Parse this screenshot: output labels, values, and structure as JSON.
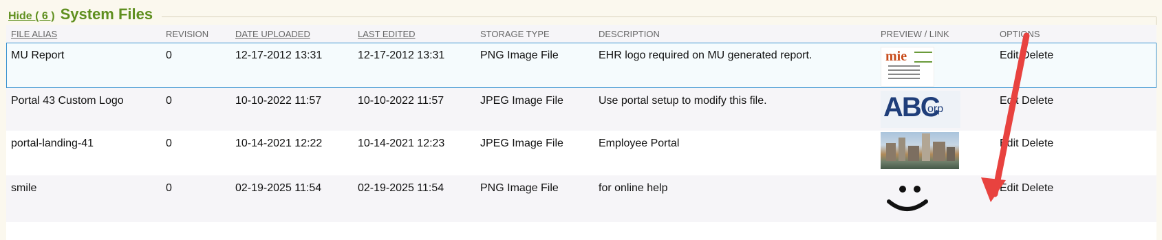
{
  "section": {
    "hide_label": "Hide ( 6 )",
    "title": "System Files"
  },
  "columns": {
    "file_alias": "FILE ALIAS",
    "revision": "REVISION",
    "date_uploaded": "DATE UPLOADED",
    "last_edited": "LAST EDITED",
    "storage_type": "STORAGE TYPE",
    "description": "DESCRIPTION",
    "preview_link": "PREVIEW / LINK",
    "options": "OPTIONS"
  },
  "rows": [
    {
      "alias": "MU Report",
      "revision": "0",
      "uploaded": "12-17-2012 13:31",
      "edited": "12-17-2012 13:31",
      "storage": "PNG Image File",
      "description": "EHR logo required on MU generated report.",
      "edit": "Edit",
      "delete": "Delete",
      "preview_icon": "mie-logo-thumbnail"
    },
    {
      "alias": "Portal 43 Custom Logo",
      "revision": "0",
      "uploaded": "10-10-2022 11:57",
      "edited": "10-10-2022 11:57",
      "storage": "JPEG Image File",
      "description": "Use portal setup to modify this file.",
      "edit": "Edit",
      "delete": "Delete",
      "preview_icon": "abc-corp-logo-thumbnail"
    },
    {
      "alias": "portal-landing-41",
      "revision": "0",
      "uploaded": "10-14-2021 12:22",
      "edited": "10-14-2021 12:23",
      "storage": "JPEG Image File",
      "description": "Employee Portal",
      "edit": "Edit",
      "delete": "Delete",
      "preview_icon": "city-photo-thumbnail"
    },
    {
      "alias": "smile",
      "revision": "0",
      "uploaded": "02-19-2025 11:54",
      "edited": "02-19-2025 11:54",
      "storage": "PNG Image File",
      "description": "for online help",
      "edit": "Edit",
      "delete": "Delete",
      "preview_icon": "smiley-thumbnail"
    }
  ],
  "thumbnails": {
    "mie_brand": "mie",
    "abc_brand": "ABC",
    "abc_suffix": "orp"
  },
  "colors": {
    "accent_green": "#5f8f1f",
    "selection_border": "#3a93d0",
    "annotation_arrow": "#e8423f"
  }
}
